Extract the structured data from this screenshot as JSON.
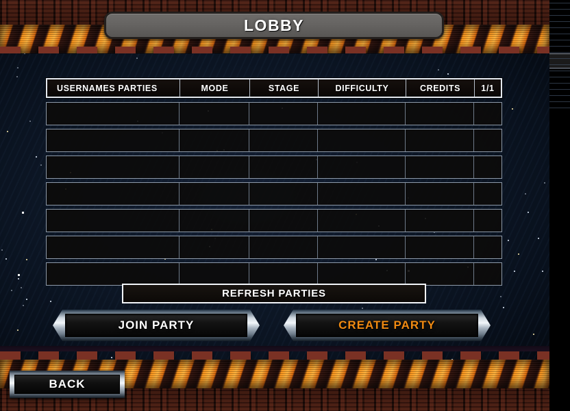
{
  "window": {
    "title": "LOBBY"
  },
  "table": {
    "columns": [
      {
        "key": "usernames_parties",
        "label": "USERNAMES PARTIES",
        "align": "left"
      },
      {
        "key": "mode",
        "label": "MODE",
        "align": "center"
      },
      {
        "key": "stage",
        "label": "STAGE",
        "align": "center"
      },
      {
        "key": "difficulty",
        "label": "DIFFICULTY",
        "align": "center"
      },
      {
        "key": "credits",
        "label": "CREDITS",
        "align": "center"
      },
      {
        "key": "page",
        "label": "1/1",
        "align": "center"
      }
    ],
    "page_indicator": "1/1",
    "row_count": 7,
    "rows": [
      {
        "usernames_parties": "",
        "mode": "",
        "stage": "",
        "difficulty": "",
        "credits": ""
      },
      {
        "usernames_parties": "",
        "mode": "",
        "stage": "",
        "difficulty": "",
        "credits": ""
      },
      {
        "usernames_parties": "",
        "mode": "",
        "stage": "",
        "difficulty": "",
        "credits": ""
      },
      {
        "usernames_parties": "",
        "mode": "",
        "stage": "",
        "difficulty": "",
        "credits": ""
      },
      {
        "usernames_parties": "",
        "mode": "",
        "stage": "",
        "difficulty": "",
        "credits": ""
      },
      {
        "usernames_parties": "",
        "mode": "",
        "stage": "",
        "difficulty": "",
        "credits": ""
      },
      {
        "usernames_parties": "",
        "mode": "",
        "stage": "",
        "difficulty": "",
        "credits": ""
      }
    ],
    "empty": true
  },
  "actions": {
    "refresh_label": "REFRESH PARTIES",
    "join_label": "JOIN PARTY",
    "create_label": "CREATE PARTY",
    "back_label": "BACK"
  },
  "colors": {
    "accent_orange": "#f08a12",
    "hazard_orange": "#ff9416",
    "text_white": "#ffffff",
    "panel_dark": "#0b0604",
    "border_light": "#e3e8ef",
    "row_border": "#8d99a8",
    "space_blue": "#0d1726",
    "title_plate": "#666462"
  }
}
